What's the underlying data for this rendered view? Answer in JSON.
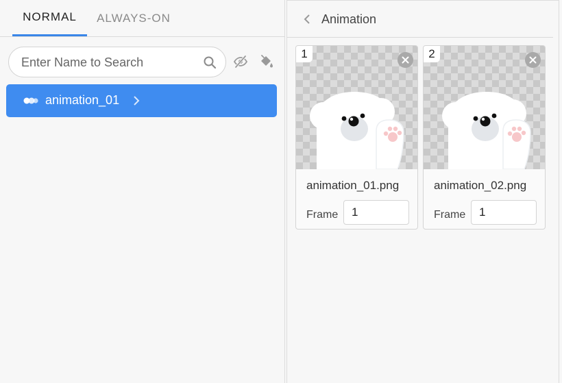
{
  "tabs": [
    {
      "label": "NORMAL",
      "active": true
    },
    {
      "label": "ALWAYS-ON",
      "active": false
    }
  ],
  "search": {
    "placeholder": "Enter Name to Search",
    "value": ""
  },
  "toolbar": {
    "visibility_icon": "eye-slash-icon",
    "fill_icon": "paint-bucket-icon"
  },
  "animation_list": [
    {
      "label": "animation_01",
      "icon": "dots-icon",
      "selected": true
    }
  ],
  "detail": {
    "back_icon": "chevron-left-icon",
    "title": "Animation",
    "frames": [
      {
        "index": "1",
        "file": "animation_01.png",
        "frame_label": "Frame",
        "frame_value": "1"
      },
      {
        "index": "2",
        "file": "animation_02.png",
        "frame_label": "Frame",
        "frame_value": "1"
      }
    ]
  },
  "colors": {
    "accent": "#3f8cf0",
    "tab_underline": "#3a86e8"
  }
}
